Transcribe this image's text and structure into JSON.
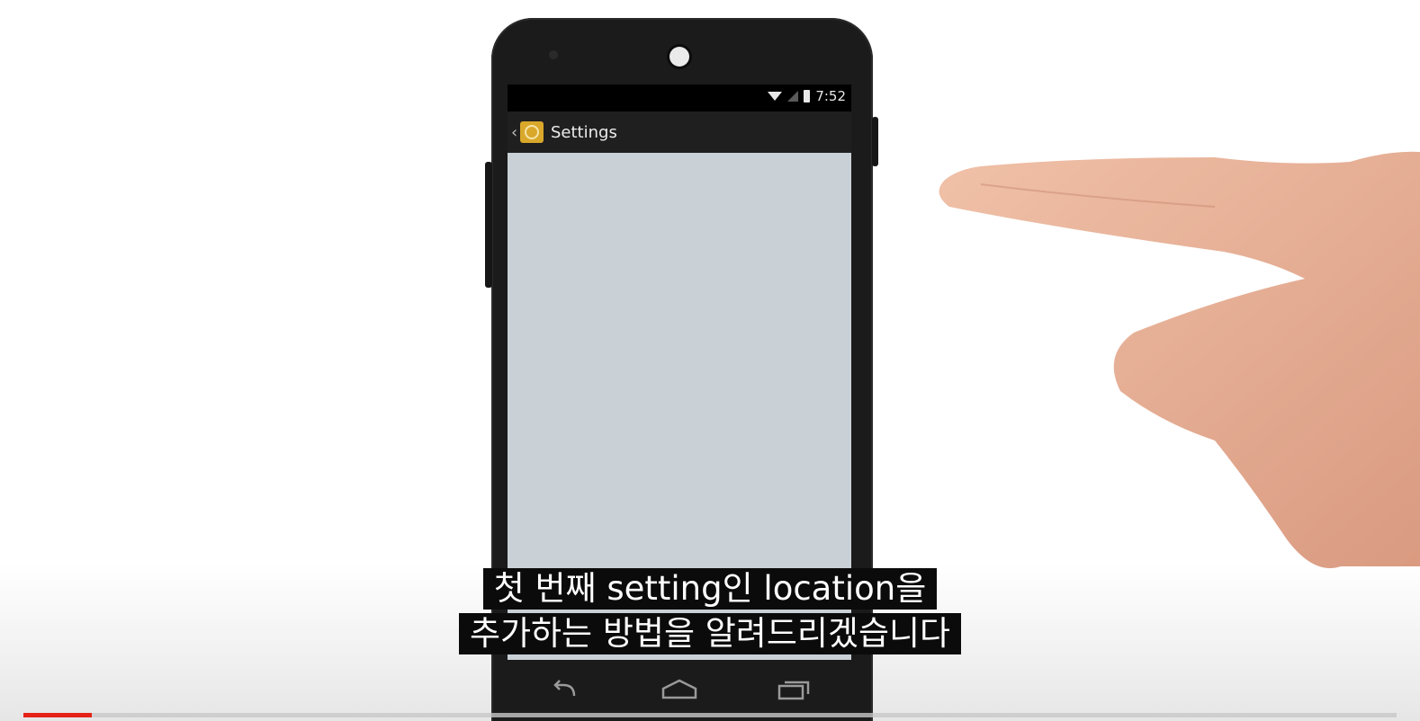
{
  "phone": {
    "status_time": "7:52",
    "app_title": "Settings",
    "icons": {
      "wifi": "wifi-icon",
      "signal": "signal-icon",
      "battery": "battery-icon",
      "up": "back-caret-icon",
      "app": "app-launcher-icon",
      "nav_back": "back-icon",
      "nav_home": "home-icon",
      "nav_recents": "recents-icon"
    },
    "colors": {
      "action_bar": "#1f1f1f",
      "content": "#c9d1d6",
      "app_icon": "#d9a82b"
    }
  },
  "captions": {
    "line1": "첫 번째 setting인 location을",
    "line2": "추가하는 방법을 알려드리겠습니다"
  },
  "player": {
    "progress_fraction": 0.05,
    "progress_color": "#e62117"
  }
}
